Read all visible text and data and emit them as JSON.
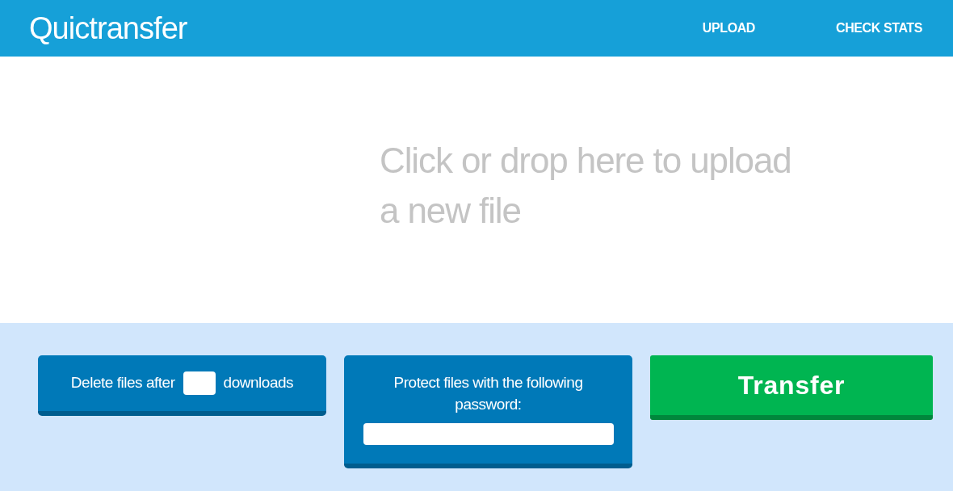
{
  "header": {
    "logo": "Quictransfer",
    "nav": [
      {
        "label": "UPLOAD"
      },
      {
        "label": "CHECK STATS"
      }
    ]
  },
  "dropzone": {
    "text": "Click or drop here to upload a new file"
  },
  "options": {
    "delete_before": "Delete files after",
    "delete_after": "downloads",
    "password_label": "Protect files with the following password:"
  },
  "submit": {
    "label": "Transfer"
  }
}
